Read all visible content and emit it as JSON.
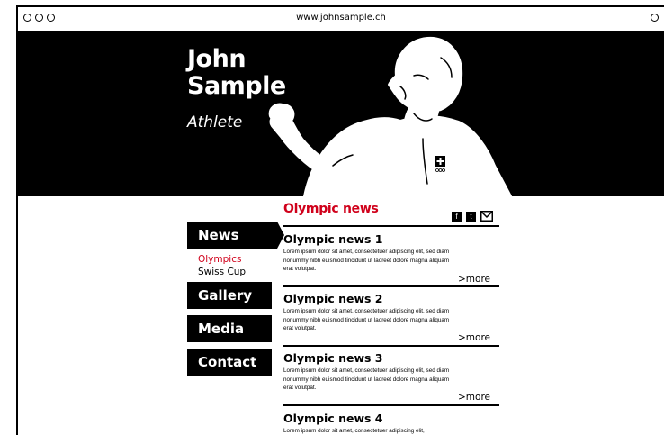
{
  "browser": {
    "url": "www.johnsample.ch"
  },
  "hero": {
    "name_line1": "John",
    "name_line2": "Sample",
    "role": "Athlete"
  },
  "nav": {
    "items": [
      {
        "label": "News"
      },
      {
        "label": "Gallery"
      },
      {
        "label": "Media"
      },
      {
        "label": "Contact"
      }
    ],
    "sub_items": [
      {
        "label": "Olympics",
        "active": true
      },
      {
        "label": "Swiss Cup",
        "active": false
      }
    ]
  },
  "content": {
    "section_title": "Olympic news",
    "social": [
      "f",
      "t",
      "email-icon"
    ],
    "articles": [
      {
        "title": "Olympic news 1",
        "body": "Lorem ipsum dolor sit amet, consectetuer adipiscing elit, sed diam nonummy nibh euismod tincidunt ut laoreet dolore magna aliquam erat volutpat.",
        "more": ">more"
      },
      {
        "title": "Olympic news 2",
        "body": "Lorem ipsum dolor sit amet, consectetuer adipiscing elit, sed diam nonummy nibh euismod tincidunt ut laoreet dolore magna aliquam erat volutpat.",
        "more": ">more"
      },
      {
        "title": "Olympic news 3",
        "body": "Lorem ipsum dolor sit amet, consectetuer adipiscing elit, sed diam nonummy nibh euismod tincidunt ut laoreet dolore magna aliquam erat volutpat.",
        "more": ">more"
      },
      {
        "title": "Olympic news 4",
        "body": "Lorem ipsum dolor sit amet, consectetuer adipiscing elit,",
        "more": ""
      }
    ]
  },
  "colors": {
    "accent": "#d0011b",
    "dark": "#000000",
    "light": "#ffffff"
  }
}
